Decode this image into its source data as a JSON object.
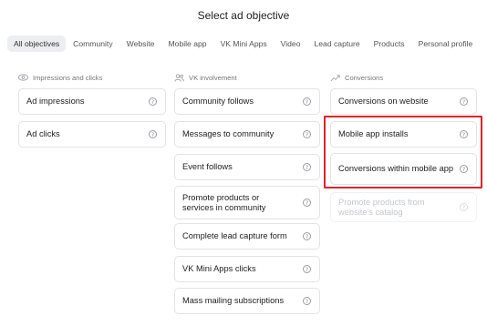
{
  "title": "Select ad objective",
  "tabs": [
    {
      "label": "All objectives",
      "active": true
    },
    {
      "label": "Community",
      "active": false
    },
    {
      "label": "Website",
      "active": false
    },
    {
      "label": "Mobile app",
      "active": false
    },
    {
      "label": "VK Mini Apps",
      "active": false
    },
    {
      "label": "Video",
      "active": false
    },
    {
      "label": "Lead capture",
      "active": false
    },
    {
      "label": "Products",
      "active": false
    },
    {
      "label": "Personal profile",
      "active": false
    }
  ],
  "columns": [
    {
      "heading": "Impressions and clicks",
      "icon": "eye-icon",
      "items": [
        "Ad impressions",
        "Ad clicks"
      ]
    },
    {
      "heading": "VK involvement",
      "icon": "people-icon",
      "items": [
        "Community follows",
        "Messages to community",
        "Event follows",
        "Promote products or services in community",
        "Complete lead capture form",
        "VK Mini Apps clicks",
        "Mass mailing subscriptions"
      ]
    },
    {
      "heading": "Conversions",
      "icon": "trend-up-icon",
      "items": [
        "Conversions on website",
        "Mobile app installs",
        "Conversions within mobile app",
        "Promote products from website's catalog"
      ],
      "disabled_item": "Promote products from website's catalog"
    }
  ],
  "help_glyph": "?",
  "colors": {
    "highlight": "#e0242b",
    "active_tab_bg": "#eceef1",
    "card_border": "#e1e3e6",
    "disabled_text": "#c4c7cc"
  }
}
